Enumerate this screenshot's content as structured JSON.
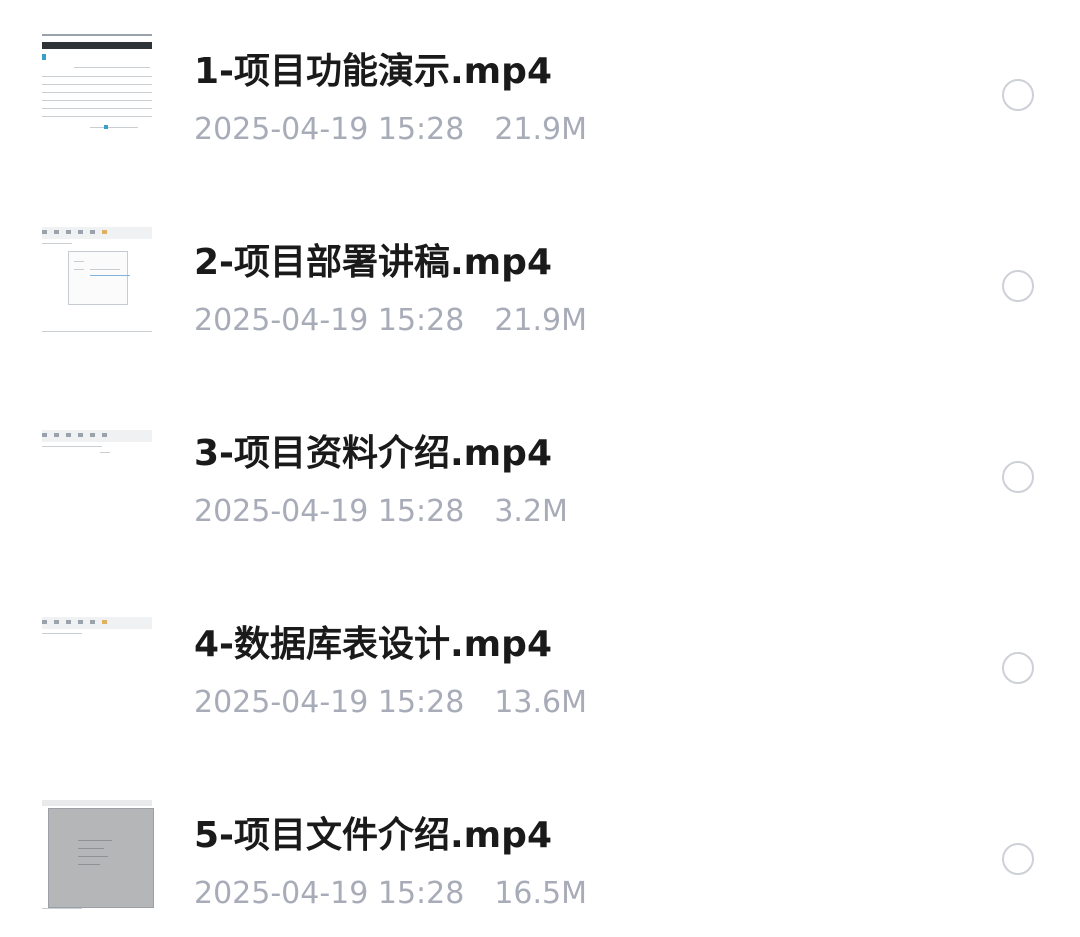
{
  "files": [
    {
      "name": "1-项目功能演示.mp4",
      "date": "2025-04-19 15:28",
      "size": "21.9M",
      "thumb_icon": "video-thumbnail-table-icon"
    },
    {
      "name": "2-项目部署讲稿.mp4",
      "date": "2025-04-19 15:28",
      "size": "21.9M",
      "thumb_icon": "video-thumbnail-dialog-icon"
    },
    {
      "name": "3-项目资料介绍.mp4",
      "date": "2025-04-19 15:28",
      "size": "3.2M",
      "thumb_icon": "video-thumbnail-toolbar-icon"
    },
    {
      "name": "4-数据库表设计.mp4",
      "date": "2025-04-19 15:28",
      "size": "13.6M",
      "thumb_icon": "video-thumbnail-toolbar-icon"
    },
    {
      "name": "5-项目文件介绍.mp4",
      "date": "2025-04-19 15:28",
      "size": "16.5M",
      "thumb_icon": "video-thumbnail-window-icon"
    }
  ],
  "colors": {
    "name_text": "#1a1a1a",
    "meta_text": "#a8acb8",
    "radio_border": "#cdd0d6"
  }
}
